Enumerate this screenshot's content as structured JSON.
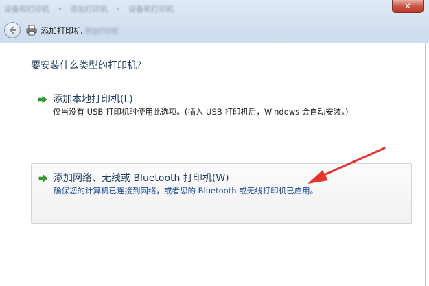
{
  "window": {
    "blurred_crumbs": [
      "设备和打印机",
      "添加打印机",
      "设备和打印机"
    ],
    "close_label": "✕",
    "title": "添加打印机",
    "title_suffix": "添加打印机"
  },
  "page": {
    "heading": "要安装什么类型的打印机?"
  },
  "options": [
    {
      "title": "添加本地打印机(L)",
      "description": "仅当没有 USB 打印机时使用此选项。(插入 USB 打印机后，Windows 会自动安装。)"
    },
    {
      "title": "添加网络、无线或 Bluetooth 打印机(W)",
      "description": "确保您的计算机已连接到网络，或者您的 Bluetooth 或无线打印机已启用。"
    }
  ],
  "colors": {
    "heading_blue": "#1e395b",
    "link_blue": "#1e4d9c",
    "arrow_green": "#2fa52f",
    "annotation_red": "#e8322a"
  },
  "icons": {
    "back": "back-arrow-icon",
    "printer": "printer-icon",
    "option_arrow": "green-right-arrow-icon"
  }
}
